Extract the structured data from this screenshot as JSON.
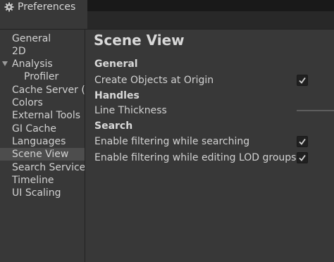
{
  "window": {
    "tab_title": "Preferences"
  },
  "sidebar": {
    "items": [
      {
        "label": "General"
      },
      {
        "label": "2D"
      },
      {
        "label": "Analysis",
        "expanded": true
      },
      {
        "label": "Profiler",
        "child": true
      },
      {
        "label": "Cache Server (g"
      },
      {
        "label": "Colors"
      },
      {
        "label": "External Tools"
      },
      {
        "label": "GI Cache"
      },
      {
        "label": "Languages"
      },
      {
        "label": "Scene View",
        "selected": true
      },
      {
        "label": "Search Service"
      },
      {
        "label": "Timeline"
      },
      {
        "label": "UI Scaling"
      }
    ]
  },
  "main": {
    "title": "Scene View",
    "sections": {
      "general": {
        "heading": "General",
        "create_objects_at_origin": {
          "label": "Create Objects at Origin",
          "checked": true
        }
      },
      "handles": {
        "heading": "Handles",
        "line_thickness": {
          "label": "Line Thickness"
        }
      },
      "search": {
        "heading": "Search",
        "filter_while_searching": {
          "label": "Enable filtering while searching",
          "checked": true
        },
        "filter_while_editing_lod": {
          "label": "Enable filtering while editing LOD groups",
          "checked": true
        }
      }
    }
  },
  "icons": {
    "tab_icon": "gear-icon",
    "foldout_icon": "triangle-down-icon",
    "checkbox_icon": "checkmark-icon"
  },
  "colors": {
    "background": "#383838",
    "titlebar": "#191919",
    "selection": "#4d4d4d",
    "checkbox_bg": "#202020",
    "checkmark": "#d8d8d8"
  }
}
